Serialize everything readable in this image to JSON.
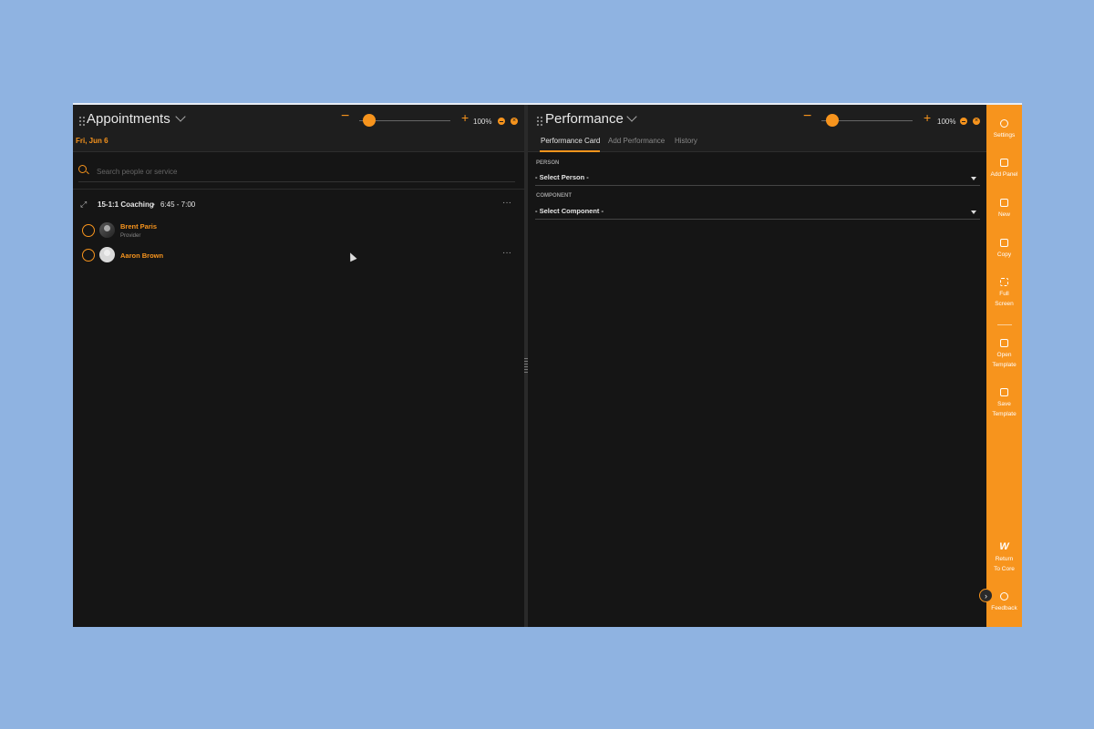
{
  "left_panel": {
    "title": "Appointments",
    "zoom": "100%",
    "zoom_minus": "−",
    "zoom_plus": "+",
    "date": "Fri, Jun 6",
    "search_placeholder": "Search people or service",
    "appointment": {
      "service": "15-1:1 Coaching",
      "separator": "•",
      "time": "6:45 - 7:00",
      "more": "···",
      "people": [
        {
          "name": "Brent Paris",
          "role": "Provider"
        },
        {
          "name": "Aaron Brown",
          "role": ""
        }
      ]
    }
  },
  "right_panel": {
    "title": "Performance",
    "zoom": "100%",
    "zoom_minus": "−",
    "zoom_plus": "+",
    "tabs": [
      "Performance Card",
      "Add Performance",
      "History"
    ],
    "fields": [
      {
        "label": "PERSON",
        "value": "- Select Person -"
      },
      {
        "label": "COMPONENT",
        "value": "- Select Component -"
      }
    ]
  },
  "rail": {
    "items": [
      {
        "label": "Settings",
        "icon": "gear-icon"
      },
      {
        "label": "Add Panel",
        "icon": "add-panel-icon"
      },
      {
        "label": "New",
        "icon": "new-icon"
      },
      {
        "label": "Copy",
        "icon": "copy-icon"
      },
      {
        "label": "Full Screen",
        "icon": "fullscreen-icon"
      },
      {
        "label": "Open Template",
        "icon": "folder-icon"
      },
      {
        "label": "Save Template",
        "icon": "save-icon"
      },
      {
        "label": "Return To Core",
        "icon": "w-logo-icon"
      },
      {
        "label": "Feedback",
        "icon": "lightbulb-icon"
      }
    ],
    "logo_letter": "W"
  },
  "colors": {
    "accent": "#f7941d",
    "background": "#151515",
    "outer": "#8fb3e1"
  }
}
